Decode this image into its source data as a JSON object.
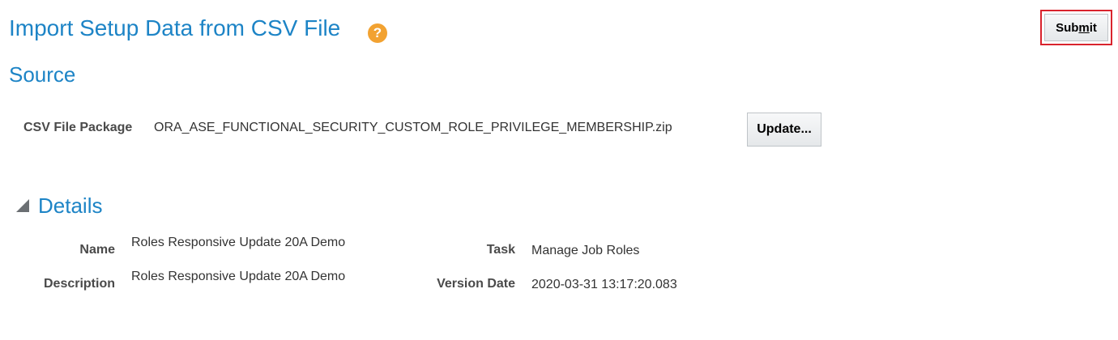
{
  "header": {
    "title": "Import Setup Data from CSV File",
    "help_icon": "?",
    "submit_label_pre": "Sub",
    "submit_label_mnemonic": "m",
    "submit_label_post": "it"
  },
  "source": {
    "section_title": "Source",
    "csv_label": "CSV File Package",
    "csv_value": "ORA_ASE_FUNCTIONAL_SECURITY_CUSTOM_ROLE_PRIVILEGE_MEMBERSHIP.zip",
    "update_label": "Update..."
  },
  "details": {
    "section_title": "Details",
    "name_label": "Name",
    "name_value": "Roles Responsive Update 20A Demo",
    "description_label": "Description",
    "description_value": "Roles Responsive Update 20A Demo",
    "task_label": "Task",
    "task_value": "Manage Job Roles",
    "version_date_label": "Version Date",
    "version_date_value": "2020-03-31 13:17:20.083"
  },
  "colors": {
    "accent": "#1d84c6",
    "help_icon": "#f2a231",
    "focus_border": "#d9232d"
  }
}
